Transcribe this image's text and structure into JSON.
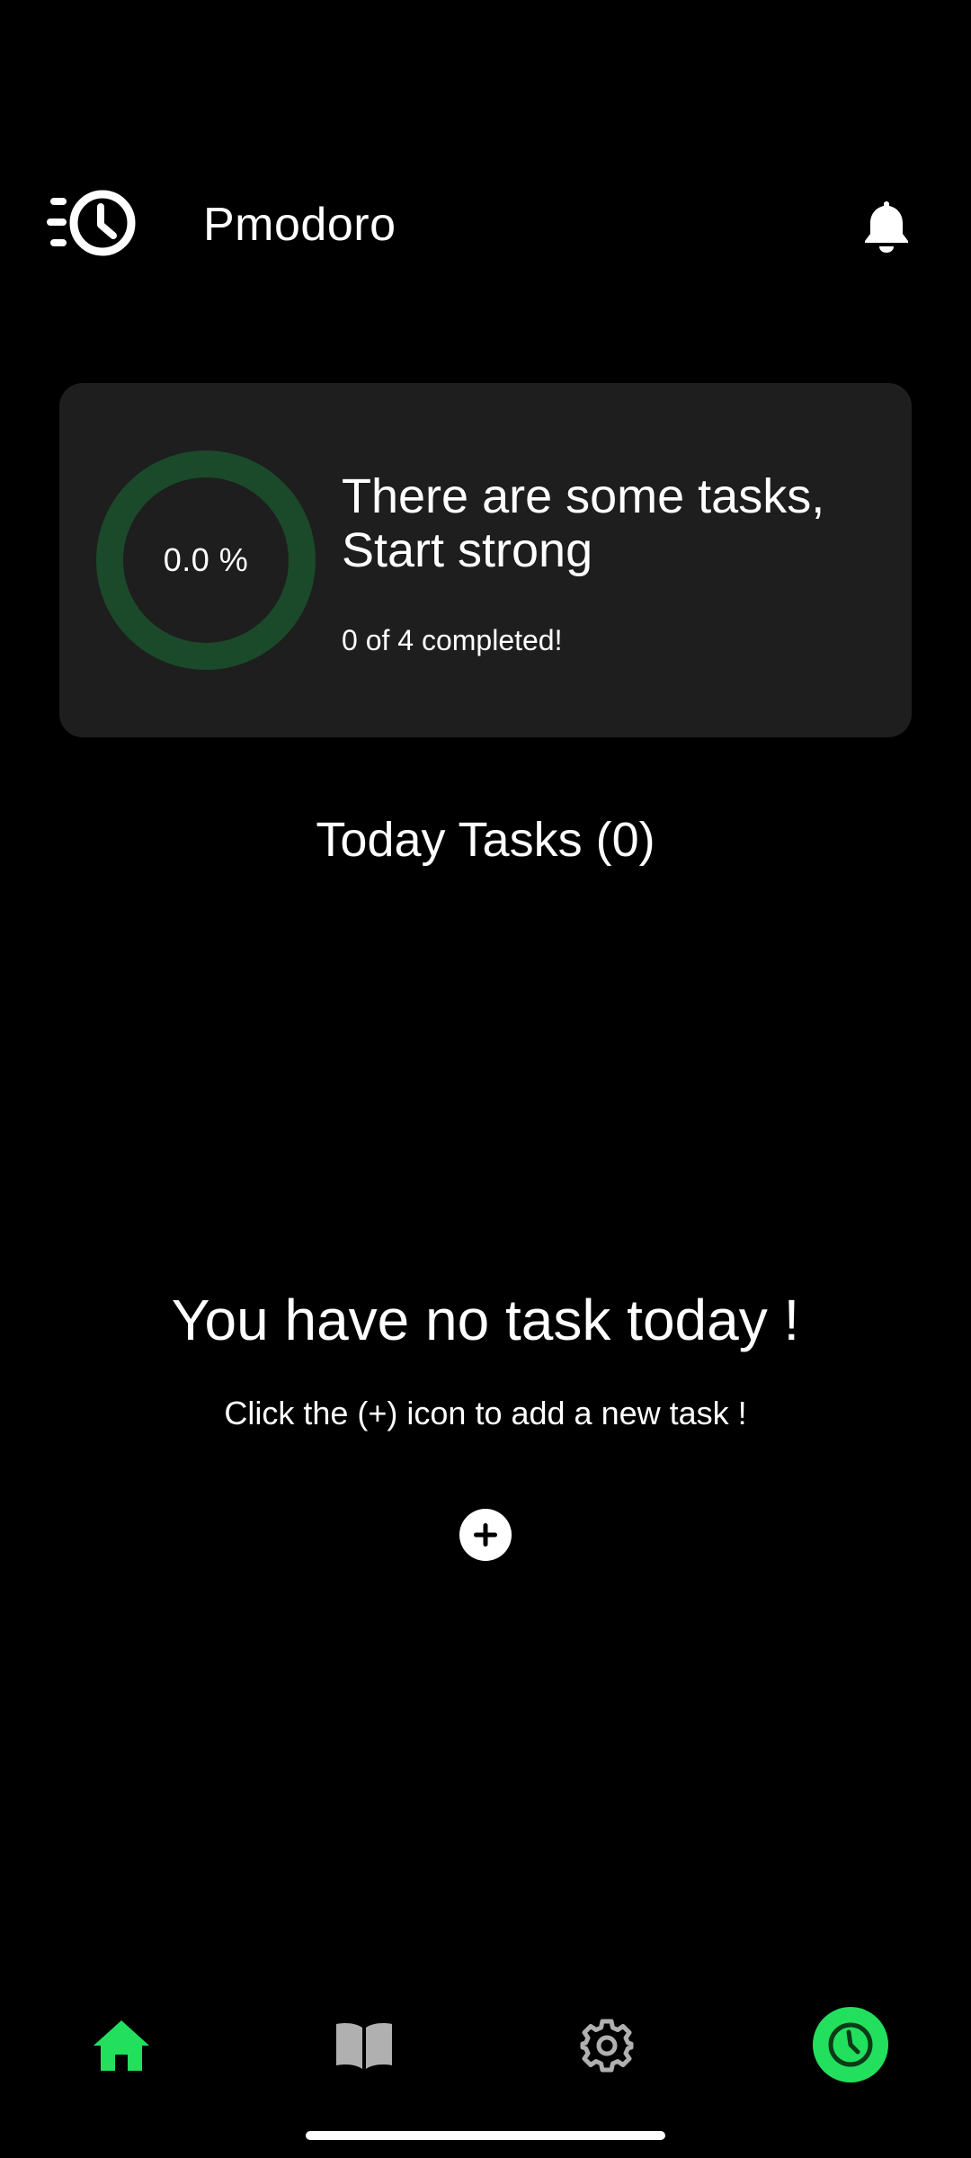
{
  "header": {
    "title": "Pmodoro",
    "logo_icon": "fast-clock-icon",
    "notification_icon": "bell-icon"
  },
  "progress_card": {
    "percent_label": "0.0 %",
    "progress_fraction": 0.0,
    "headline": "There are some tasks, Start strong",
    "completed_text": "0 of 4 completed!"
  },
  "today": {
    "title": "Today Tasks (0)"
  },
  "empty_state": {
    "title": "You have no task today !",
    "hint": "Click the (+) icon to add a new task !",
    "add_icon": "plus-icon"
  },
  "bottom_nav": {
    "items": [
      {
        "icon": "home-icon",
        "active": true
      },
      {
        "icon": "book-icon",
        "active": false
      },
      {
        "icon": "gear-icon",
        "active": false
      },
      {
        "icon": "timer-icon",
        "active": false
      }
    ]
  },
  "colors": {
    "background": "#000000",
    "card": "#1e1e1e",
    "accent": "#22e05d",
    "ring_track": "#1b4a2a",
    "inactive_icon": "#b0b0b0"
  }
}
